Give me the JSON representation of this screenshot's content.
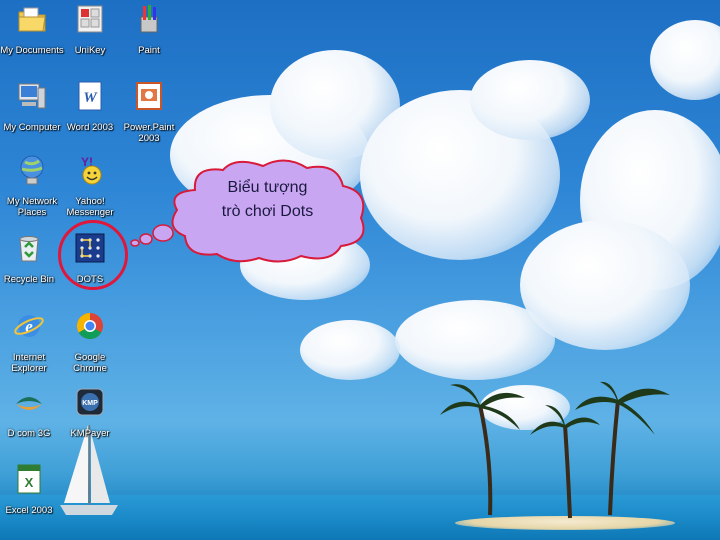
{
  "desktop": {
    "icons": [
      {
        "label": "My Documents",
        "icon": "folder-documents-icon"
      },
      {
        "label": "UniKey",
        "icon": "unikey-icon"
      },
      {
        "label": "Paint",
        "icon": "paint-icon"
      },
      {
        "label": "My Computer",
        "icon": "computer-icon"
      },
      {
        "label": "Word 2003",
        "icon": "word-icon"
      },
      {
        "label": "Power.Paint\n2003",
        "icon": "powerpoint-icon"
      },
      {
        "label": "My Network\nPlaces",
        "icon": "network-icon"
      },
      {
        "label": "Yahoo!\nMessenger",
        "icon": "yahoo-messenger-icon"
      },
      {
        "label": "Recycle Bin",
        "icon": "recycle-bin-icon"
      },
      {
        "label": "DOTS",
        "icon": "dots-game-icon"
      },
      {
        "label": "Internet\nExplorer",
        "icon": "internet-explorer-icon"
      },
      {
        "label": "Google Chrome",
        "icon": "chrome-icon"
      },
      {
        "label": "D com 3G",
        "icon": "dcom-3g-icon"
      },
      {
        "label": "KMPayer",
        "icon": "kmplayer-icon"
      },
      {
        "label": "Excel 2003",
        "icon": "excel-icon"
      }
    ]
  },
  "callout": {
    "text": "Biểu tượng\ntrò chơi Dots",
    "fill": "#c9a6f2",
    "border": "#d81b3a"
  }
}
